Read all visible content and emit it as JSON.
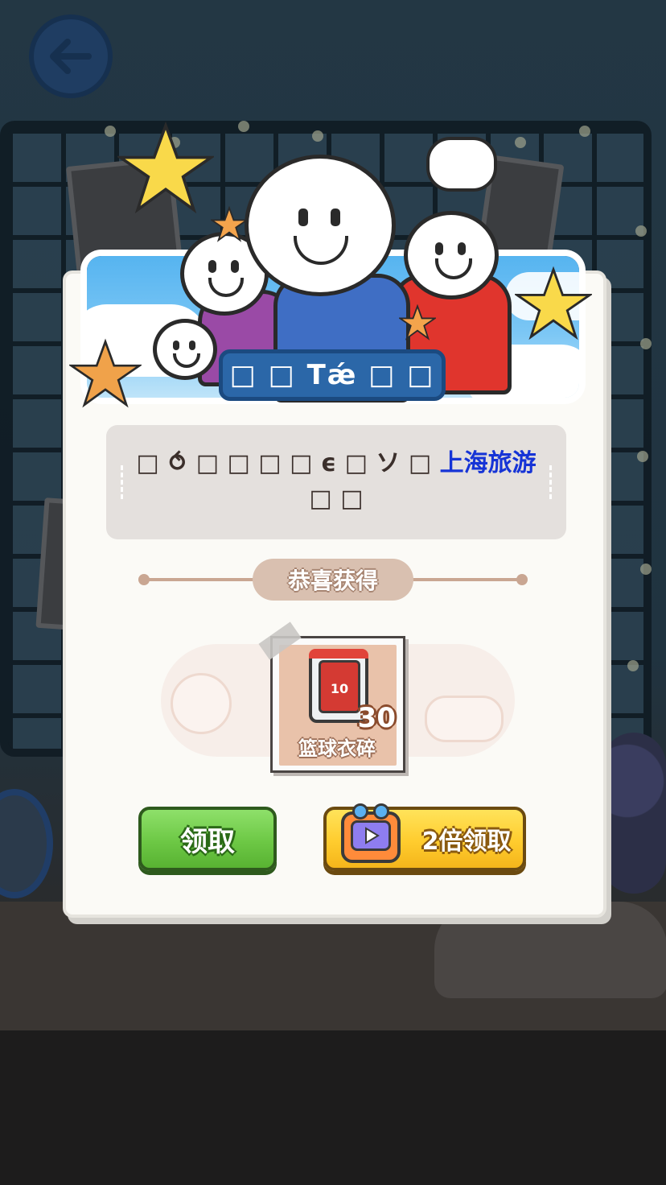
{
  "header": {
    "back_icon": "arrow-left-icon"
  },
  "dialog": {
    "title": "□ □ Tǽ □ □",
    "message_prefix": "□ ⥀ □ □ □ □ ϵ □ ソ □ ",
    "message_highlight": "上海旅游",
    "message_suffix": " □ □",
    "highlight_color": "#1634d6",
    "congrats_label": "恭喜获得"
  },
  "reward": {
    "item_name": "篮球衣碎",
    "quantity": "30",
    "jersey_number": "10",
    "icon": "basketball-jersey-icon"
  },
  "buttons": {
    "claim_label": "领取",
    "double_claim_label": "2倍领取",
    "double_claim_icon": "tv-play-icon",
    "claim_color": "#6dc845",
    "double_color": "#ffcc2e"
  }
}
